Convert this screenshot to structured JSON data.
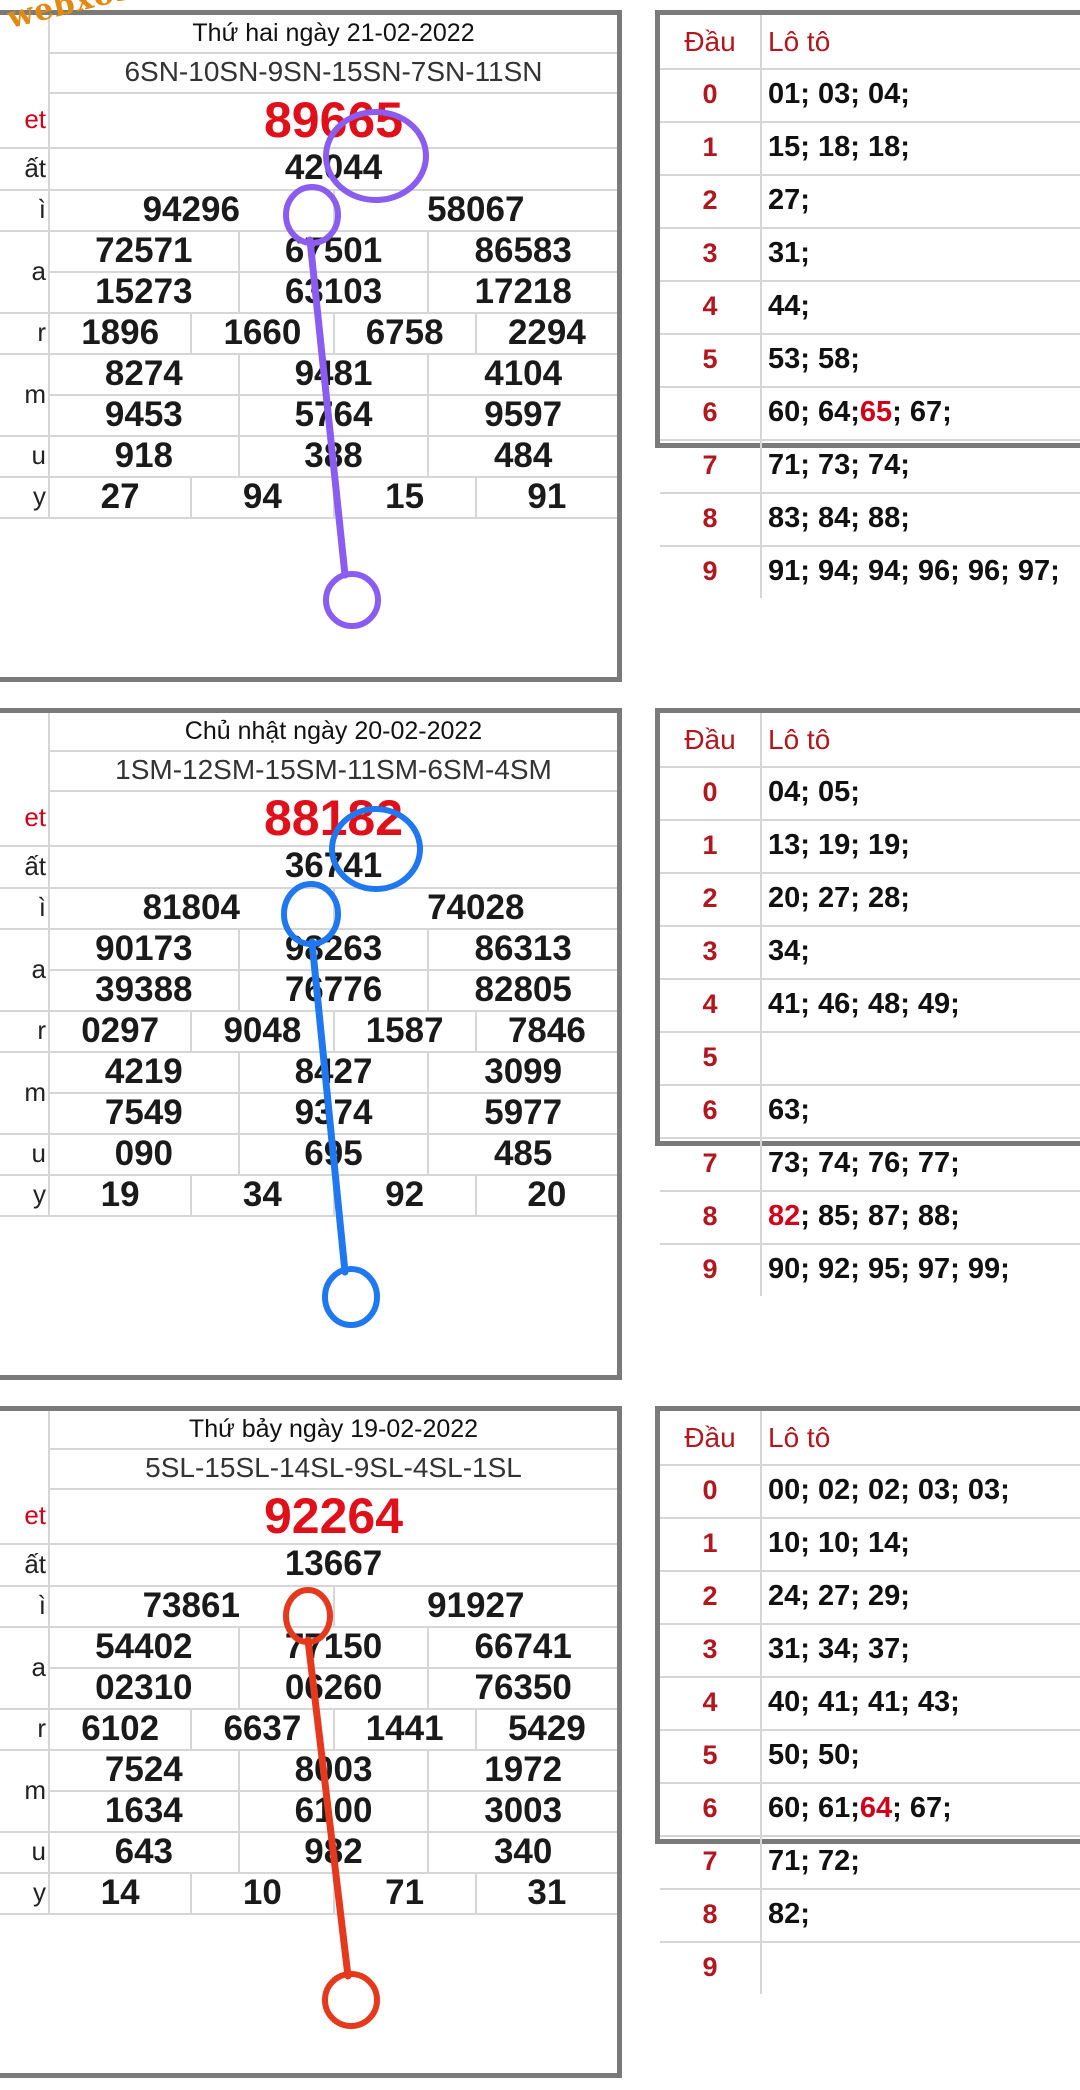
{
  "watermark": "webxoso.net",
  "blocks": [
    {
      "title": "Thứ hai ngày 21-02-2022",
      "codes": "6SN-10SN-9SN-15SN-7SN-11SN",
      "labels": [
        "et",
        "ất",
        "ì",
        "a",
        "",
        "r",
        "m",
        "",
        "u",
        "y"
      ],
      "special": "89665",
      "first": "42044",
      "second": [
        "94296",
        "58067"
      ],
      "third": [
        [
          "72571",
          "67501",
          "86583"
        ],
        [
          "15273",
          "63103",
          "17218"
        ]
      ],
      "fourth": [
        "1896",
        "1660",
        "6758",
        "2294"
      ],
      "fifth": [
        [
          "8274",
          "9481",
          "4104"
        ],
        [
          "9453",
          "5764",
          "9597"
        ]
      ],
      "sixth": [
        "918",
        "388",
        "484"
      ],
      "seventh": [
        "27",
        "94",
        "15",
        "91"
      ],
      "loto_head": [
        "Đầu",
        "Lô tô"
      ],
      "loto": [
        {
          "d": "0",
          "parts": [
            "01; 03; 04;"
          ]
        },
        {
          "d": "1",
          "parts": [
            "15; 18; 18;"
          ]
        },
        {
          "d": "2",
          "parts": [
            "27;"
          ]
        },
        {
          "d": "3",
          "parts": [
            "31;"
          ]
        },
        {
          "d": "4",
          "parts": [
            "44;"
          ]
        },
        {
          "d": "5",
          "parts": [
            "53; 58;"
          ]
        },
        {
          "d": "6",
          "parts": [
            "60; 64; ",
            "65",
            "; 67;"
          ]
        },
        {
          "d": "7",
          "parts": [
            "71; 73; 74;"
          ]
        },
        {
          "d": "8",
          "parts": [
            "83; 84; 88;"
          ]
        },
        {
          "d": "9",
          "parts": [
            "91; 94; 94; 96; 96; 97;"
          ]
        }
      ],
      "mark_color": "#8a5cf0"
    },
    {
      "title": "Chủ nhật ngày 20-02-2022",
      "codes": "1SM-12SM-15SM-11SM-6SM-4SM",
      "labels": [
        "et",
        "ất",
        "ì",
        "a",
        "",
        "r",
        "m",
        "",
        "u",
        "y"
      ],
      "special": "88182",
      "first": "36741",
      "second": [
        "81804",
        "74028"
      ],
      "third": [
        [
          "90173",
          "98263",
          "86313"
        ],
        [
          "39388",
          "76776",
          "82805"
        ]
      ],
      "fourth": [
        "0297",
        "9048",
        "1587",
        "7846"
      ],
      "fifth": [
        [
          "4219",
          "8427",
          "3099"
        ],
        [
          "7549",
          "9374",
          "5977"
        ]
      ],
      "sixth": [
        "090",
        "695",
        "485"
      ],
      "seventh": [
        "19",
        "34",
        "92",
        "20"
      ],
      "loto_head": [
        "Đầu",
        "Lô tô"
      ],
      "loto": [
        {
          "d": "0",
          "parts": [
            "04; 05;"
          ]
        },
        {
          "d": "1",
          "parts": [
            "13; 19; 19;"
          ]
        },
        {
          "d": "2",
          "parts": [
            "20; 27; 28;"
          ]
        },
        {
          "d": "3",
          "parts": [
            "34;"
          ]
        },
        {
          "d": "4",
          "parts": [
            "41; 46; 48; 49;"
          ]
        },
        {
          "d": "5",
          "parts": [
            ""
          ]
        },
        {
          "d": "6",
          "parts": [
            "63;"
          ]
        },
        {
          "d": "7",
          "parts": [
            "73; 74; 76; 77;"
          ]
        },
        {
          "d": "8",
          "parts": [
            "",
            "82",
            "; 85; 87; 88;"
          ]
        },
        {
          "d": "9",
          "parts": [
            "90; 92; 95; 97; 99;"
          ]
        }
      ],
      "mark_color": "#1f78f0"
    },
    {
      "title": "Thứ bảy ngày 19-02-2022",
      "codes": "5SL-15SL-14SL-9SL-4SL-1SL",
      "labels": [
        "et",
        "ất",
        "ì",
        "a",
        "",
        "r",
        "m",
        "",
        "u",
        "y"
      ],
      "special": "92264",
      "first": "13667",
      "second": [
        "73861",
        "91927"
      ],
      "third": [
        [
          "54402",
          "77150",
          "66741"
        ],
        [
          "02310",
          "06260",
          "76350"
        ]
      ],
      "fourth": [
        "6102",
        "6637",
        "1441",
        "5429"
      ],
      "fifth": [
        [
          "7524",
          "8003",
          "1972"
        ],
        [
          "1634",
          "6100",
          "3003"
        ]
      ],
      "sixth": [
        "643",
        "982",
        "340"
      ],
      "seventh": [
        "14",
        "10",
        "71",
        "31"
      ],
      "loto_head": [
        "Đầu",
        "Lô tô"
      ],
      "loto": [
        {
          "d": "0",
          "parts": [
            "00; 02; 02; 03; 03;"
          ]
        },
        {
          "d": "1",
          "parts": [
            "10; 10; 14;"
          ]
        },
        {
          "d": "2",
          "parts": [
            "24; 27; 29;"
          ]
        },
        {
          "d": "3",
          "parts": [
            "31; 34; 37;"
          ]
        },
        {
          "d": "4",
          "parts": [
            "40; 41; 41; 43;"
          ]
        },
        {
          "d": "5",
          "parts": [
            "50; 50;"
          ]
        },
        {
          "d": "6",
          "parts": [
            "60; 61; ",
            "64",
            "; 67;"
          ]
        },
        {
          "d": "7",
          "parts": [
            "71; 72;"
          ]
        },
        {
          "d": "8",
          "parts": [
            "82;"
          ]
        },
        {
          "d": "9",
          "parts": [
            ""
          ]
        }
      ],
      "mark_color": "#e5391e"
    }
  ]
}
